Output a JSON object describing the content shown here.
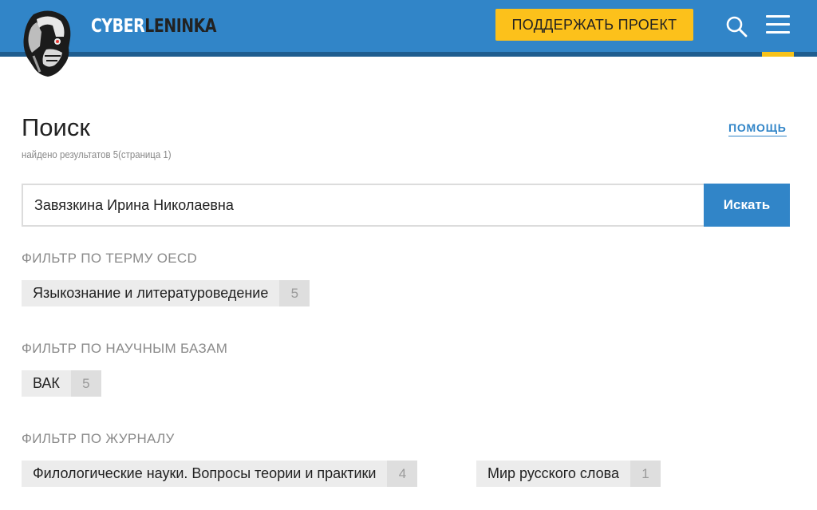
{
  "header": {
    "logo_part1": "CYBER",
    "logo_part2": "LENINKA",
    "support_label": "ПОДДЕРЖАТЬ ПРОЕКТ",
    "colors": {
      "bar": "#3185c8",
      "stripe": "#1f5d8f",
      "accent": "#fcc11b"
    }
  },
  "page": {
    "title": "Поиск",
    "results": "найдено результатов 5(страница 1)",
    "help": "помощь"
  },
  "search": {
    "value": "Завязкина Ирина Николаевна",
    "button": "Искать"
  },
  "filters": [
    {
      "heading": "ФИЛЬТР ПО ТЕРМУ OECD",
      "chips": [
        {
          "label": "Языкознание и литературоведение",
          "count": "5"
        }
      ]
    },
    {
      "heading": "ФИЛЬТР ПО НАУЧНЫМ БАЗАМ",
      "chips": [
        {
          "label": "ВАК",
          "count": "5"
        }
      ]
    },
    {
      "heading": "ФИЛЬТР ПО ЖУРНАЛУ",
      "chips": [
        {
          "label": "Филологические науки. Вопросы теории и практики",
          "count": "4"
        },
        {
          "label": "Мир русского слова",
          "count": "1"
        }
      ]
    }
  ],
  "icons": [
    "robot-lenin-logo-icon",
    "search-icon",
    "hamburger-menu-icon"
  ]
}
